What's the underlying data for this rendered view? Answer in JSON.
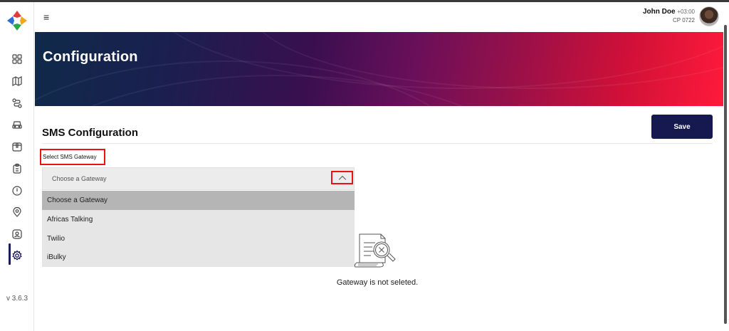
{
  "sidebar": {
    "items": [
      {
        "name": "dashboard",
        "icon": "grid-icon"
      },
      {
        "name": "map",
        "icon": "map-icon"
      },
      {
        "name": "routes",
        "icon": "route-icon"
      },
      {
        "name": "vehicles",
        "icon": "car-icon"
      },
      {
        "name": "packages",
        "icon": "box-icon"
      },
      {
        "name": "orders",
        "icon": "clipboard-icon"
      },
      {
        "name": "alerts",
        "icon": "alert-icon"
      },
      {
        "name": "locations",
        "icon": "location-pin-icon"
      },
      {
        "name": "users",
        "icon": "user-badge-icon"
      },
      {
        "name": "configuration",
        "icon": "gear-icon",
        "active": true
      }
    ],
    "version": "v 3.6.3",
    "accent_color": "#1a1a5e"
  },
  "header": {
    "user_name": "John Doe",
    "user_timezone": "+03:00",
    "user_code": "CP 0722"
  },
  "banner": {
    "title": "Configuration"
  },
  "main": {
    "section_title": "SMS Configuration",
    "save_label": "Save",
    "field_label": "Select SMS Gateway",
    "select": {
      "value": "Choose a Gateway",
      "options": [
        "Choose a Gateway",
        "Africas Talking",
        "Twilio",
        "iBulky"
      ],
      "selected_index": 0,
      "expanded": true
    },
    "empty_state": "Gateway is not seleted."
  },
  "colors": {
    "primary_button": "#161850",
    "highlight_border": "#ee1111"
  }
}
